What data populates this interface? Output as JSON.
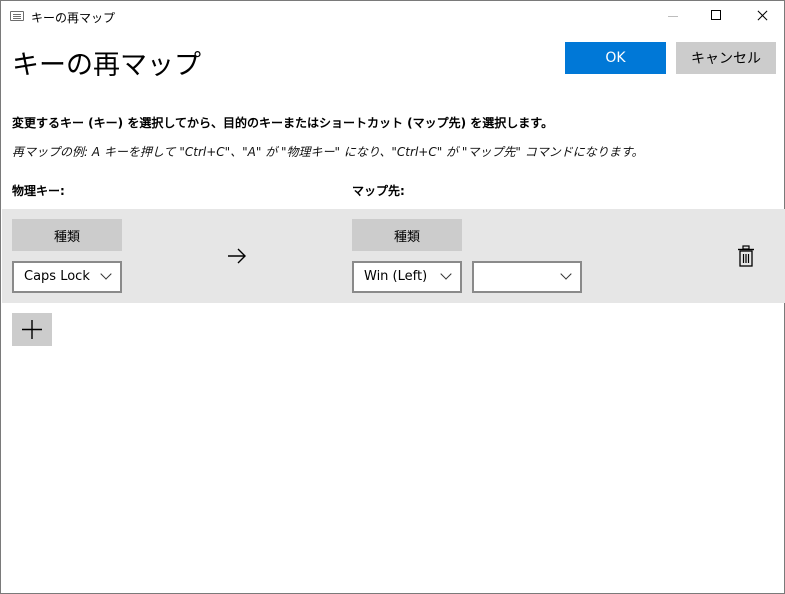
{
  "window": {
    "title": "キーの再マップ",
    "icons": {
      "app": "keyboard-icon",
      "minimize": "minimize-icon",
      "maximize": "maximize-icon",
      "close": "close-icon"
    }
  },
  "header": {
    "title": "キーの再マップ",
    "ok_label": "OK",
    "cancel_label": "キャンセル"
  },
  "instructions": {
    "text": "変更するキー (キー) を選択してから、目的のキーまたはショートカット (マップ先) を選択します。",
    "example": "再マップの例: A キーを押して \"Ctrl+C\"、\"A\" が \"物理キー\" になり、\"Ctrl+C\" が \"マップ先\" コマンドになります。"
  },
  "columns": {
    "physical": "物理キー:",
    "mapped": "マップ先:"
  },
  "rows": [
    {
      "source_type_label": "種類",
      "source_key": "Caps Lock",
      "target_type_label": "種類",
      "target_key": "Win (Left)",
      "target_key2": "",
      "arrow_icon": "arrow-right-icon",
      "delete_icon": "trash-icon"
    }
  ],
  "add_icon": "plus-icon",
  "colors": {
    "accent": "#0078d7",
    "row_bg": "#e6e6e6",
    "button_bg": "#cccccc"
  }
}
